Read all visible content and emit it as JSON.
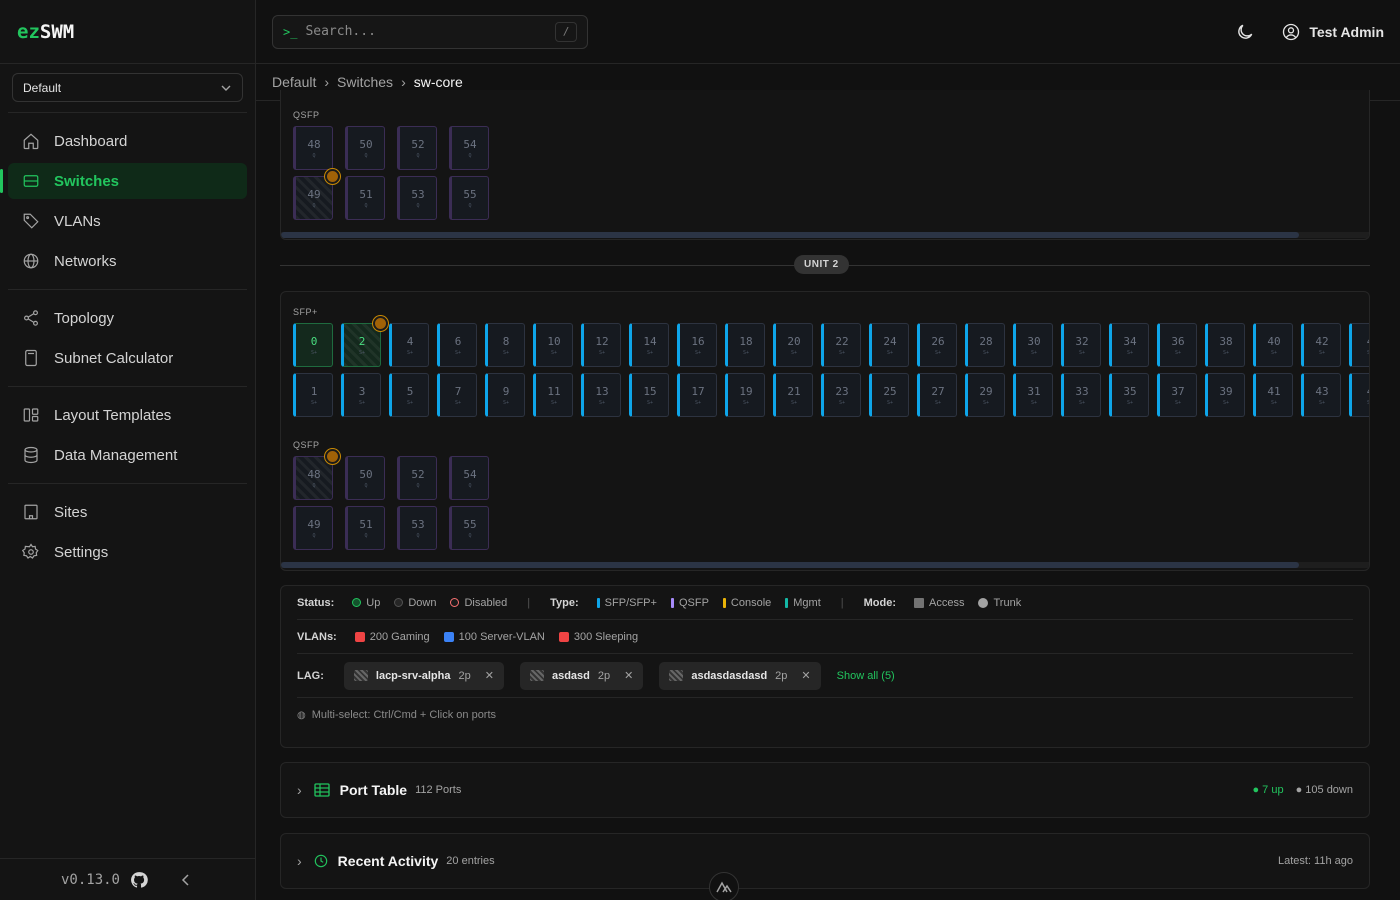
{
  "logo": {
    "prefix": "ez",
    "suffix": "SWM"
  },
  "site_select": {
    "value": "Default"
  },
  "nav": {
    "dashboard": "Dashboard",
    "switches": "Switches",
    "vlans": "VLANs",
    "networks": "Networks",
    "topology": "Topology",
    "subnet": "Subnet Calculator",
    "layout": "Layout Templates",
    "data": "Data Management",
    "sites": "Sites",
    "settings": "Settings"
  },
  "version": "v0.13.0",
  "search": {
    "placeholder": "Search...",
    "prompt": ">_",
    "shortcut": "/"
  },
  "user": {
    "name": "Test Admin"
  },
  "breadcrumb": [
    "Default",
    "Switches",
    "sw-core"
  ],
  "unit1": {
    "qsfp_label": "QSFP",
    "qsfp_top": [
      "48",
      "50",
      "52",
      "54"
    ],
    "qsfp_bottom": [
      "49",
      "51",
      "53",
      "55"
    ],
    "qsfp_sub": "Q"
  },
  "unit_divider": "UNIT 2",
  "unit2": {
    "sfp_label": "SFP+",
    "sfp_top": [
      "0",
      "2",
      "4",
      "6",
      "8",
      "10",
      "12",
      "14",
      "16",
      "18",
      "20",
      "22",
      "24",
      "26",
      "28",
      "30",
      "32",
      "34",
      "36",
      "38",
      "40",
      "42",
      "4"
    ],
    "sfp_bottom": [
      "1",
      "3",
      "5",
      "7",
      "9",
      "11",
      "13",
      "15",
      "17",
      "19",
      "21",
      "23",
      "25",
      "27",
      "29",
      "31",
      "33",
      "35",
      "37",
      "39",
      "41",
      "43",
      "4"
    ],
    "sfp_sub": "S+",
    "qsfp_label": "QSFP",
    "qsfp_top": [
      "48",
      "50",
      "52",
      "54"
    ],
    "qsfp_bottom": [
      "49",
      "51",
      "53",
      "55"
    ],
    "qsfp_sub": "Q"
  },
  "legend": {
    "status_label": "Status:",
    "status": [
      "Up",
      "Down",
      "Disabled"
    ],
    "type_label": "Type:",
    "types": [
      "SFP/SFP+",
      "QSFP",
      "Console",
      "Mgmt"
    ],
    "mode_label": "Mode:",
    "modes": [
      "Access",
      "Trunk"
    ],
    "vlans_label": "VLANs:",
    "vlans": [
      {
        "name": "200 Gaming",
        "color": "#ef4444"
      },
      {
        "name": "100 Server-VLAN",
        "color": "#3b82f6"
      },
      {
        "name": "300 Sleeping",
        "color": "#ef4444"
      }
    ],
    "lag_label": "LAG:",
    "lags": [
      {
        "name": "lacp-srv-alpha",
        "count": "2p"
      },
      {
        "name": "asdasd",
        "count": "2p"
      },
      {
        "name": "asdasdasdasd",
        "count": "2p"
      }
    ],
    "show_all": "Show all (5)",
    "hint": "Multi-select: Ctrl/Cmd + Click on ports"
  },
  "port_table": {
    "title": "Port Table",
    "count": "112 Ports",
    "up": "7 up",
    "down": "105 down"
  },
  "activity": {
    "title": "Recent Activity",
    "count": "20 entries",
    "latest": "Latest: 11h ago"
  },
  "colors": {
    "accent": "#22c55e",
    "sfp": "#0ea5e9",
    "qsfp": "#7c3aed",
    "console": "#eab308",
    "mgmt": "#14b8a6"
  }
}
